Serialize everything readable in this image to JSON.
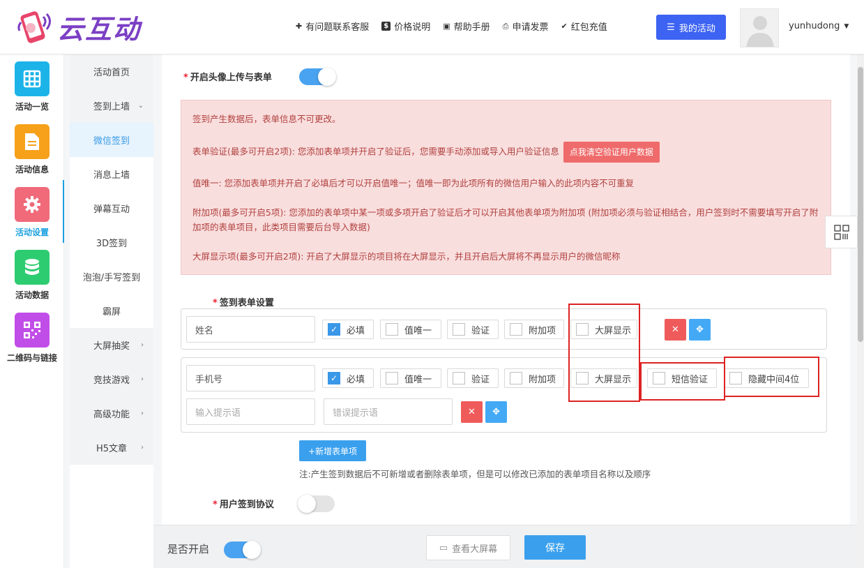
{
  "brand": {
    "name": "云互动"
  },
  "header": {
    "nav": [
      {
        "icon": "user-plus-icon",
        "label": "有问题联系客服"
      },
      {
        "icon": "dollar-icon",
        "label": "价格说明"
      },
      {
        "icon": "book-icon",
        "label": "帮助手册"
      },
      {
        "icon": "printer-icon",
        "label": "申请发票"
      },
      {
        "icon": "shield-check-icon",
        "label": "红包充值"
      }
    ],
    "my_activity_label": "我的活动",
    "username": "yunhudong"
  },
  "sidebar": {
    "items": [
      {
        "label": "活动一览",
        "icon": "grid-icon",
        "color": "#1cb4e8"
      },
      {
        "label": "活动信息",
        "icon": "document-icon",
        "color": "#f7a11a"
      },
      {
        "label": "活动设置",
        "icon": "gear-icon",
        "color": "#f06a7a",
        "active": true
      },
      {
        "label": "活动数据",
        "icon": "database-icon",
        "color": "#2ecc71"
      },
      {
        "label": "二维码与链接",
        "icon": "qrcode-icon",
        "color": "#c14de8"
      }
    ]
  },
  "submenu": {
    "items": [
      {
        "label": "活动首页"
      },
      {
        "label": "签到上墙",
        "arrow": "⌄"
      },
      {
        "label": "微信签到",
        "sub": true,
        "active": true
      },
      {
        "label": "消息上墙",
        "sub": true
      },
      {
        "label": "弹幕互动",
        "sub": true
      },
      {
        "label": "3D签到",
        "sub": true
      },
      {
        "label": "泡泡/手写签到",
        "sub": true
      },
      {
        "label": "霸屏",
        "sub": true
      },
      {
        "label": "大屏抽奖",
        "arrow": "›"
      },
      {
        "label": "竞技游戏",
        "arrow": "›"
      },
      {
        "label": "高级功能",
        "arrow": "›"
      },
      {
        "label": "H5文章",
        "arrow": "›"
      }
    ]
  },
  "main": {
    "avatar_form": {
      "label": "开启头像上传与表单",
      "enabled": true
    },
    "alert": {
      "line1": "签到产生数据后，表单信息不可更改。",
      "line2": "表单验证(最多可开启2项): 您添加表单项并开启了验证后，您需要手动添加或导入用户验证信息",
      "clear_button": "点我清空验证用户数据",
      "line3": "值唯一: 您添加表单项并开启了必填后才可以开启值唯一；值唯一即为此项所有的微信用户输入的此项内容不可重复",
      "line4": "附加项(最多可开启5项): 您添加的表单项中某一项或多项开启了验证后才可以开启其他表单项为附加项 (附加项必须与验证相结合，用户签到时不需要填写开启了附加项的表单项目，此类项目需要后台导入数据)",
      "line5": "大屏显示项(最多可开启2项): 开启了大屏显示的项目将在大屏显示，并且开启后大屏将不再显示用户的微信昵称"
    },
    "form_settings_label": "签到表单设置",
    "options": {
      "required": "必填",
      "unique": "值唯一",
      "verify": "验证",
      "extra": "附加项",
      "screen": "大屏显示",
      "sms": "短信验证",
      "hide_mid": "隐藏中间4位"
    },
    "rows": [
      {
        "name": "姓名",
        "required": true
      },
      {
        "name": "手机号",
        "required": true,
        "hint_placeholder": "输入提示语",
        "error_placeholder": "错误提示语"
      }
    ],
    "add_button": "+新增表单项",
    "note": "注:产生签到数据后不可新增或者删除表单项，但是可以修改已添加的表单项目名称以及顺序",
    "agreement": {
      "label": "用户签到协议",
      "enabled": false
    }
  },
  "bottom": {
    "open_label": "是否开启",
    "open_enabled": true,
    "view_screen": "查看大屏幕",
    "save": "保存"
  }
}
